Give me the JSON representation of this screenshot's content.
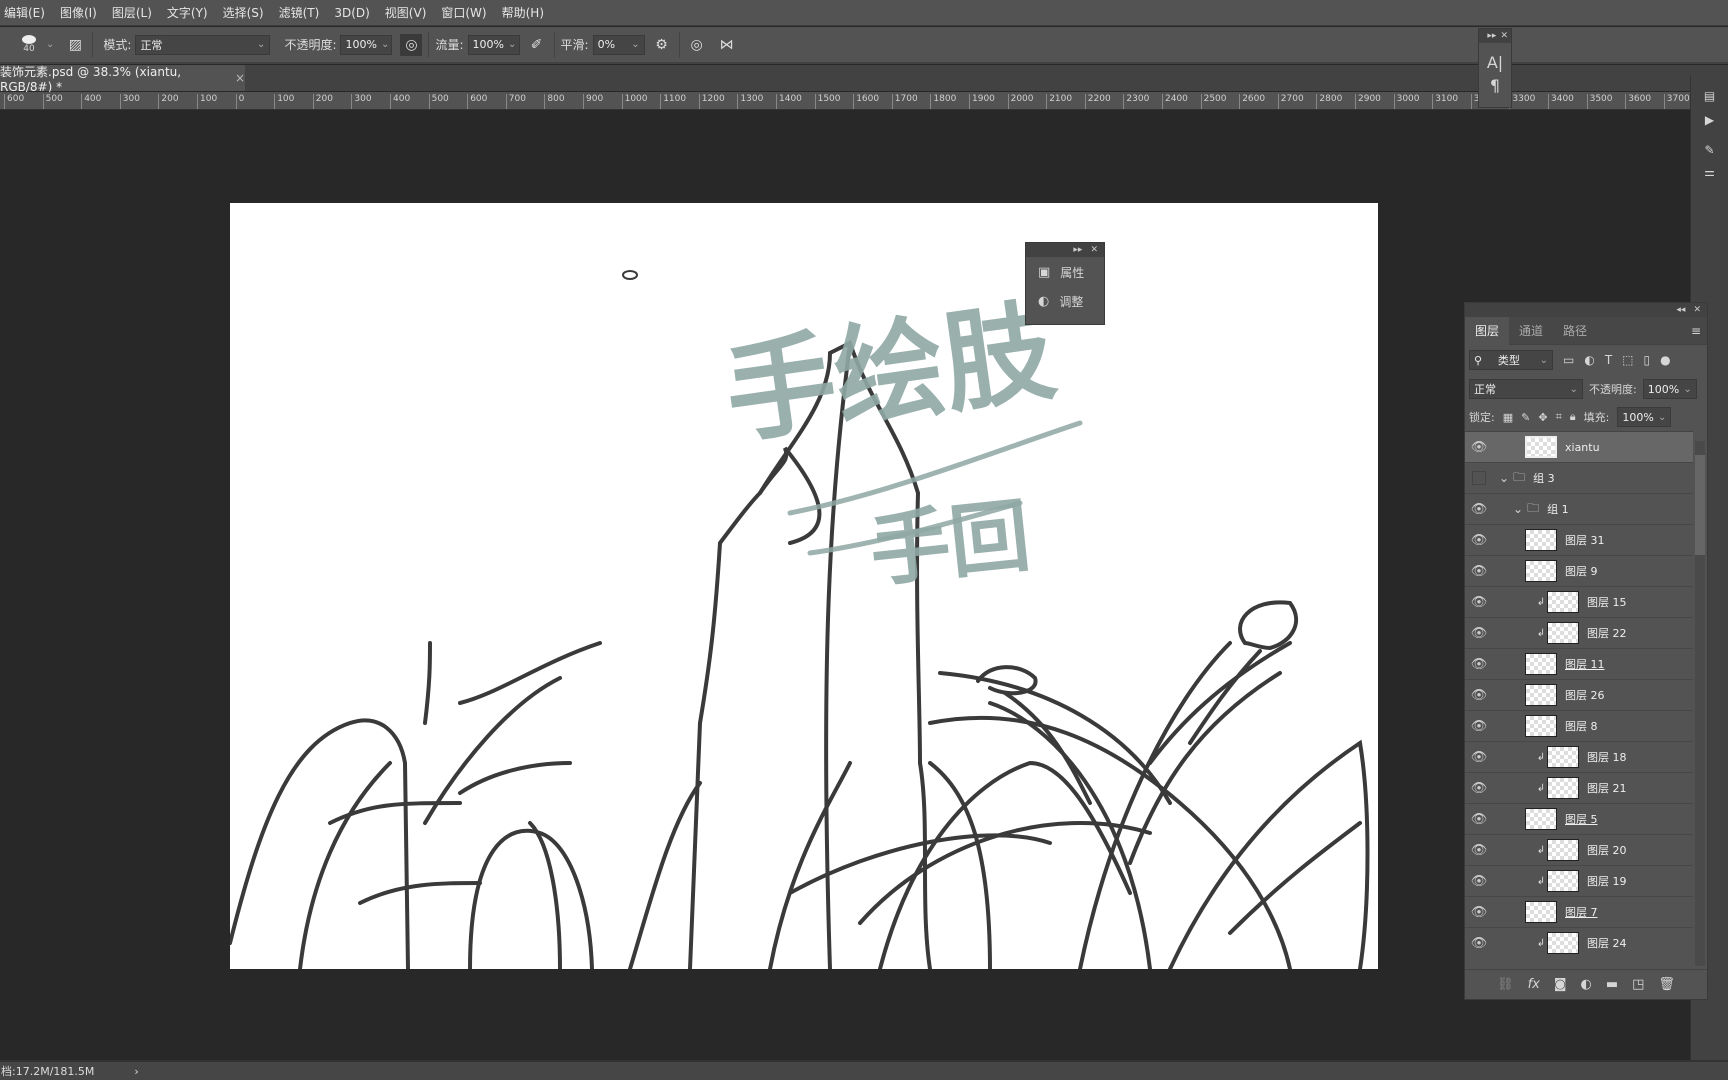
{
  "menu": [
    "编辑(E)",
    "图像(I)",
    "图层(L)",
    "文字(Y)",
    "选择(S)",
    "滤镜(T)",
    "3D(D)",
    "视图(V)",
    "窗口(W)",
    "帮助(H)"
  ],
  "options": {
    "brush_size": "40",
    "mode_label": "模式:",
    "mode_value": "正常",
    "opacity_label": "不透明度:",
    "opacity_value": "100%",
    "flow_label": "流量:",
    "flow_value": "100%",
    "smooth_label": "平滑:",
    "smooth_value": "0%"
  },
  "doc_tab": {
    "title": "装饰元素.psd @ 38.3% (xiantu, RGB/8#) *",
    "close": "×"
  },
  "ruler_labels": [
    "600",
    "500",
    "400",
    "300",
    "200",
    "100",
    "0",
    "100",
    "200",
    "300",
    "400",
    "500",
    "600",
    "700",
    "800",
    "900",
    "1000",
    "1100",
    "1200",
    "1300",
    "1400",
    "1500",
    "1600",
    "1700",
    "1800",
    "1900",
    "2000",
    "2100",
    "2200",
    "2300",
    "2400",
    "2500",
    "2600",
    "2700",
    "2800",
    "2900",
    "3000",
    "3100",
    "3200",
    "3300",
    "3400",
    "3500",
    "3600",
    "3700"
  ],
  "props_panel": {
    "properties": "属性",
    "adjustments": "调整"
  },
  "char_panel": {
    "character": "A|",
    "paragraph": "¶"
  },
  "layers_panel": {
    "tabs": [
      "图层",
      "通道",
      "路径"
    ],
    "filter": "类型",
    "blend": "正常",
    "opacity_label": "不透明度:",
    "opacity": "100%",
    "lock_label": "锁定:",
    "fill_label": "填充:",
    "fill": "100%",
    "layers": [
      {
        "name": "xiantu",
        "type": "layer",
        "visible": true,
        "selected": true,
        "indent": 0
      },
      {
        "name": "组 3",
        "type": "group",
        "visible": false,
        "indent": 0
      },
      {
        "name": "组 1",
        "type": "group",
        "visible": true,
        "indent": 1
      },
      {
        "name": "图层 31",
        "type": "layer",
        "visible": true,
        "indent": 2
      },
      {
        "name": "图层 9",
        "type": "layer",
        "visible": true,
        "indent": 2
      },
      {
        "name": "图层 15",
        "type": "clip",
        "visible": true,
        "indent": 2
      },
      {
        "name": "图层 22",
        "type": "clip",
        "visible": true,
        "indent": 2
      },
      {
        "name": "图层 11",
        "type": "layer",
        "visible": true,
        "indent": 2,
        "underline": true
      },
      {
        "name": "图层 26",
        "type": "layer",
        "visible": true,
        "indent": 2
      },
      {
        "name": "图层 8",
        "type": "layer",
        "visible": true,
        "indent": 2
      },
      {
        "name": "图层 18",
        "type": "clip",
        "visible": true,
        "indent": 2
      },
      {
        "name": "图层 21",
        "type": "clip",
        "visible": true,
        "indent": 2
      },
      {
        "name": "图层 5",
        "type": "layer",
        "visible": true,
        "indent": 2,
        "underline": true
      },
      {
        "name": "图层 20",
        "type": "clip",
        "visible": true,
        "indent": 2
      },
      {
        "name": "图层 19",
        "type": "clip",
        "visible": true,
        "indent": 2
      },
      {
        "name": "图层 7",
        "type": "layer",
        "visible": true,
        "indent": 2,
        "underline": true
      },
      {
        "name": "图层 24",
        "type": "clip",
        "visible": true,
        "indent": 2
      }
    ]
  },
  "status": {
    "doc_size": "档:17.2M/181.5M",
    "arrow": "›"
  },
  "canvas_text": {
    "line1": "手绘肢",
    "line2": "手回"
  },
  "colors": {
    "ui": "#535353",
    "canvas_bg": "#282828",
    "sketch": "#333333",
    "lettering": "#8fa8a4"
  }
}
